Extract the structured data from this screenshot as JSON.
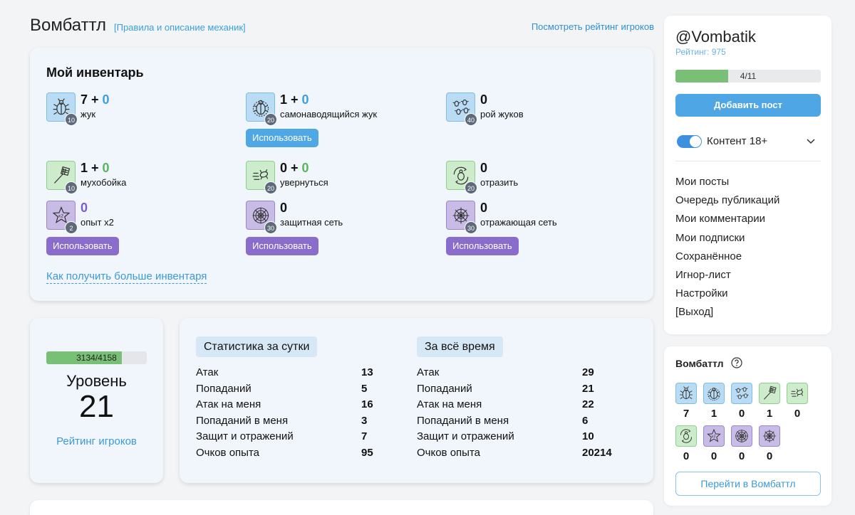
{
  "header": {
    "title": "Вомбаттл",
    "rules_link": "[Правила и описание механик]",
    "rating_link": "Посмотреть рейтинг игроков"
  },
  "inventory": {
    "title": "Мой инвентарь",
    "use_label": "Использовать",
    "more_link": "Как получить больше инвентаря",
    "items": [
      {
        "name": "жук",
        "base": "7",
        "plus": "0",
        "cost": "10",
        "icon": "beetle-icon",
        "color": "blue"
      },
      {
        "name": "самонаводящийся жук",
        "base": "1",
        "plus": "0",
        "cost": "20",
        "icon": "homing-beetle-icon",
        "color": "blue"
      },
      {
        "name": "рой жуков",
        "base": "0",
        "plus": "",
        "cost": "40",
        "icon": "beetle-swarm-icon",
        "color": "blue"
      },
      {
        "name": "мухобойка",
        "base": "1",
        "plus": "0",
        "cost": "10",
        "icon": "flyswatter-icon",
        "color": "green"
      },
      {
        "name": "увернуться",
        "base": "0",
        "plus": "0",
        "cost": "20",
        "icon": "dodge-icon",
        "color": "green"
      },
      {
        "name": "отразить",
        "base": "0",
        "plus": "",
        "cost": "20",
        "icon": "reflect-icon",
        "color": "green"
      },
      {
        "name": "опыт x2",
        "base": "0",
        "plus": "",
        "cost": "2",
        "icon": "star-x2-icon",
        "color": "purple"
      },
      {
        "name": "защитная сеть",
        "base": "0",
        "plus": "",
        "cost": "30",
        "icon": "web-icon",
        "color": "purple"
      },
      {
        "name": "отражающая сеть",
        "base": "0",
        "plus": "",
        "cost": "30",
        "icon": "reflect-web-icon",
        "color": "purple"
      }
    ]
  },
  "level": {
    "progress_text": "3134/4158",
    "progress_fraction": 0.754,
    "label": "Уровень",
    "value": "21",
    "rating_link": "Рейтинг игроков"
  },
  "stats": {
    "daily": {
      "title": "Статистика за сутки",
      "rows": [
        {
          "k": "Атак",
          "v": "13"
        },
        {
          "k": "Попаданий",
          "v": "5"
        },
        {
          "k": "Атак на меня",
          "v": "16"
        },
        {
          "k": "Попаданий в меня",
          "v": "3"
        },
        {
          "k": "Защит и отражений",
          "v": "7"
        },
        {
          "k": "Очков опыта",
          "v": "95"
        }
      ]
    },
    "all": {
      "title": "За всё время",
      "rows": [
        {
          "k": "Атак",
          "v": "29"
        },
        {
          "k": "Попаданий",
          "v": "21"
        },
        {
          "k": "Атак на меня",
          "v": "22"
        },
        {
          "k": "Попаданий в меня",
          "v": "6"
        },
        {
          "k": "Защит и отражений",
          "v": "10"
        },
        {
          "k": "Очков опыта",
          "v": "20214"
        }
      ]
    }
  },
  "profile": {
    "username": "@Vombatik",
    "rating": "Рейтинг: 975",
    "progress_text": "4/11",
    "progress_fraction": 0.364,
    "add_post": "Добавить пост",
    "content_toggle": "Контент 18+",
    "menu": [
      "Мои посты",
      "Очередь публикаций",
      "Мои комментарии",
      "Мои подписки",
      "Сохранённое",
      "Игнор-лист",
      "Настройки",
      "[Выход]"
    ]
  },
  "battle_widget": {
    "title": "Вомбаттл",
    "button": "Перейти в Вомбаттл",
    "items": [
      {
        "icon": "beetle-icon",
        "color": "blue",
        "count": "7"
      },
      {
        "icon": "homing-beetle-icon",
        "color": "blue",
        "count": "1"
      },
      {
        "icon": "beetle-swarm-icon",
        "color": "blue",
        "count": "0"
      },
      {
        "icon": "flyswatter-icon",
        "color": "green",
        "count": "1"
      },
      {
        "icon": "dodge-icon",
        "color": "green",
        "count": "0"
      },
      {
        "icon": "reflect-icon",
        "color": "green",
        "count": "0"
      },
      {
        "icon": "star-x2-icon",
        "color": "purple",
        "count": "0"
      },
      {
        "icon": "web-icon",
        "color": "purple",
        "count": "0"
      },
      {
        "icon": "reflect-web-icon",
        "color": "purple",
        "count": "0"
      }
    ]
  }
}
